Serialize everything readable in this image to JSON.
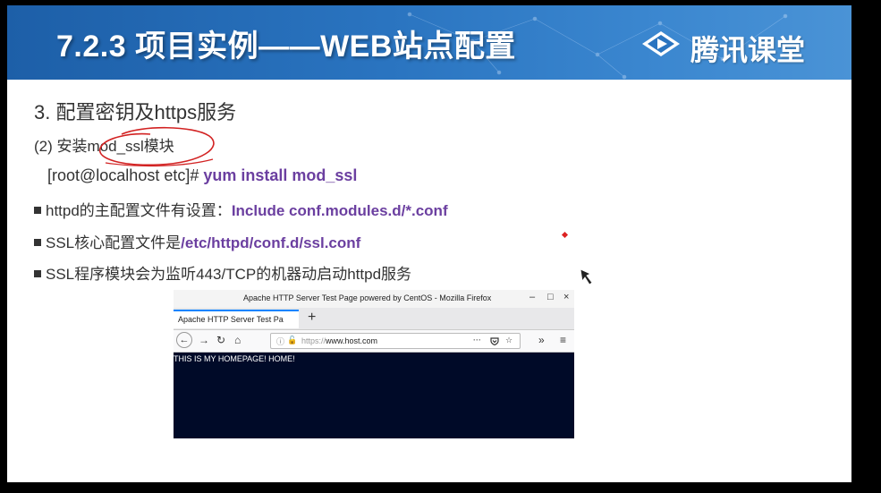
{
  "banner": {
    "title": "7.2.3  项目实例——WEB站点配置",
    "brand_name": "腾讯课堂"
  },
  "content": {
    "section_title": "3. 配置密钥及https服务",
    "subsection_title": "(2) 安装mod_ssl模块",
    "command": {
      "prompt": "[root@localhost  etc]# ",
      "text": "yum install mod_ssl"
    },
    "bullets": [
      {
        "text": "httpd的主配置文件有设置：",
        "highlight": "Include  conf.modules.d/*.conf"
      },
      {
        "text": "SSL核心配置文件是",
        "highlight": "/etc/httpd/conf.d/ssl.conf"
      },
      {
        "text": "SSL程序模块会为监听443/TCP的机器动启动httpd服务",
        "highlight": ""
      }
    ]
  },
  "browser": {
    "window_title": "Apache HTTP Server Test Page powered by CentOS - Mozilla Firefox",
    "tab_label": "Apache HTTP Server Test Pa",
    "new_tab": "+",
    "url_scheme": "https://",
    "url_host": "www.host.com",
    "controls": {
      "minimize": "–",
      "maximize": "□",
      "close": "×"
    },
    "nav": {
      "back": "←",
      "forward": "→",
      "reload": "↻",
      "home": "⌂",
      "more": "···",
      "star": "☆",
      "overflow": "»",
      "menu": "≡"
    },
    "page_text": "THIS IS MY HOMEPAGE! HOME!"
  },
  "colors": {
    "banner": "#2a74c0",
    "highlight": "#6b3fa0",
    "annotation": "#d22222",
    "page_background": "#000a28"
  }
}
